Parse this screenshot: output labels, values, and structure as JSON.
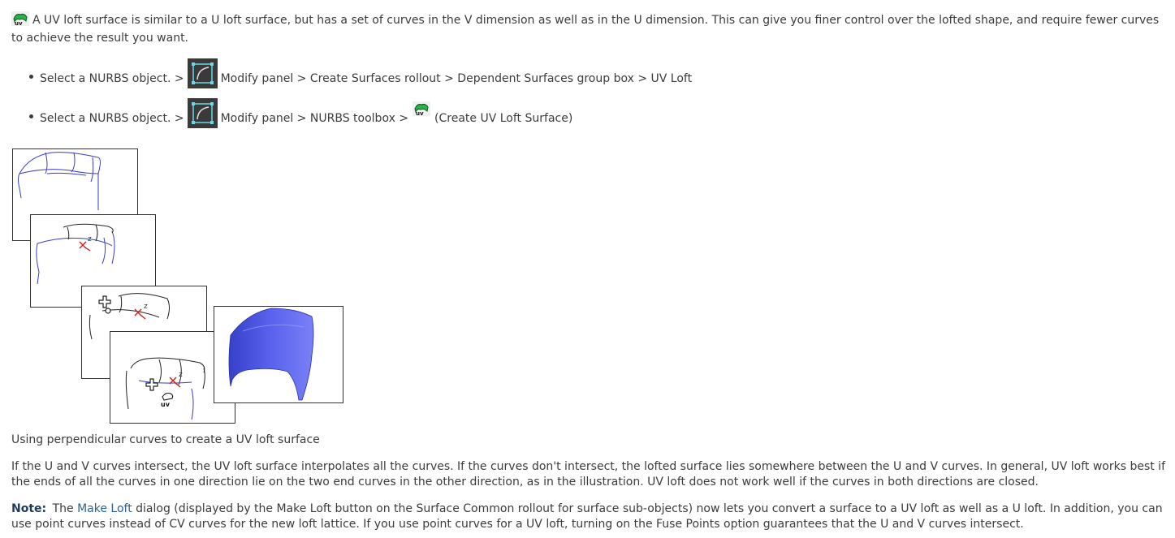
{
  "intro": {
    "text": "A UV loft surface is similar to a U loft surface, but has a set of curves in the V dimension as well as in the U dimension. This can give you finer control over the lofted shape, and require fewer curves to achieve the result you want."
  },
  "steps": [
    {
      "before": "Select a NURBS object. >",
      "after": "Modify panel > Create Surfaces rollout > Dependent Surfaces group box > UV Loft"
    },
    {
      "before": "Select a NURBS object. >",
      "middle": "Modify panel > NURBS toolbox >",
      "after": "(Create UV Loft Surface)"
    }
  ],
  "figure": {
    "axis_label": "z",
    "caption": "Using perpendicular curves to create a UV loft surface"
  },
  "body_paragraph": "If the U and V curves intersect, the UV loft surface interpolates all the curves. If the curves don't intersect, the lofted surface lies somewhere between the U and V curves. In general, UV loft works best if the ends of all the curves in one direction lie on the two end curves in the other direction, as in the illustration. UV loft does not work well if the curves in both directions are closed.",
  "note": {
    "label": "Note:",
    "pre": "The",
    "link": "Make Loft",
    "text": "dialog (displayed by the Make Loft button on the Surface Common rollout for surface sub-objects) now lets you convert a surface to a UV loft as well as a U loft. In addition, you can use point curves instead of CV curves for the new loft lattice. If you use point curves for a UV loft, turning on the Fuse Points option guarantees that the U and V curves intersect."
  },
  "colors": {
    "text": "#3c3c3c",
    "curve_blue": "#3a3acc",
    "surface_blue": "#4f55e8",
    "axis_red": "#cc1a1a",
    "icon_dark": "#3a3a3a",
    "icon_cyan": "#6fd6e6",
    "link": "#2a6496"
  },
  "icons": [
    "uv-loft-icon",
    "modify-panel-icon"
  ]
}
